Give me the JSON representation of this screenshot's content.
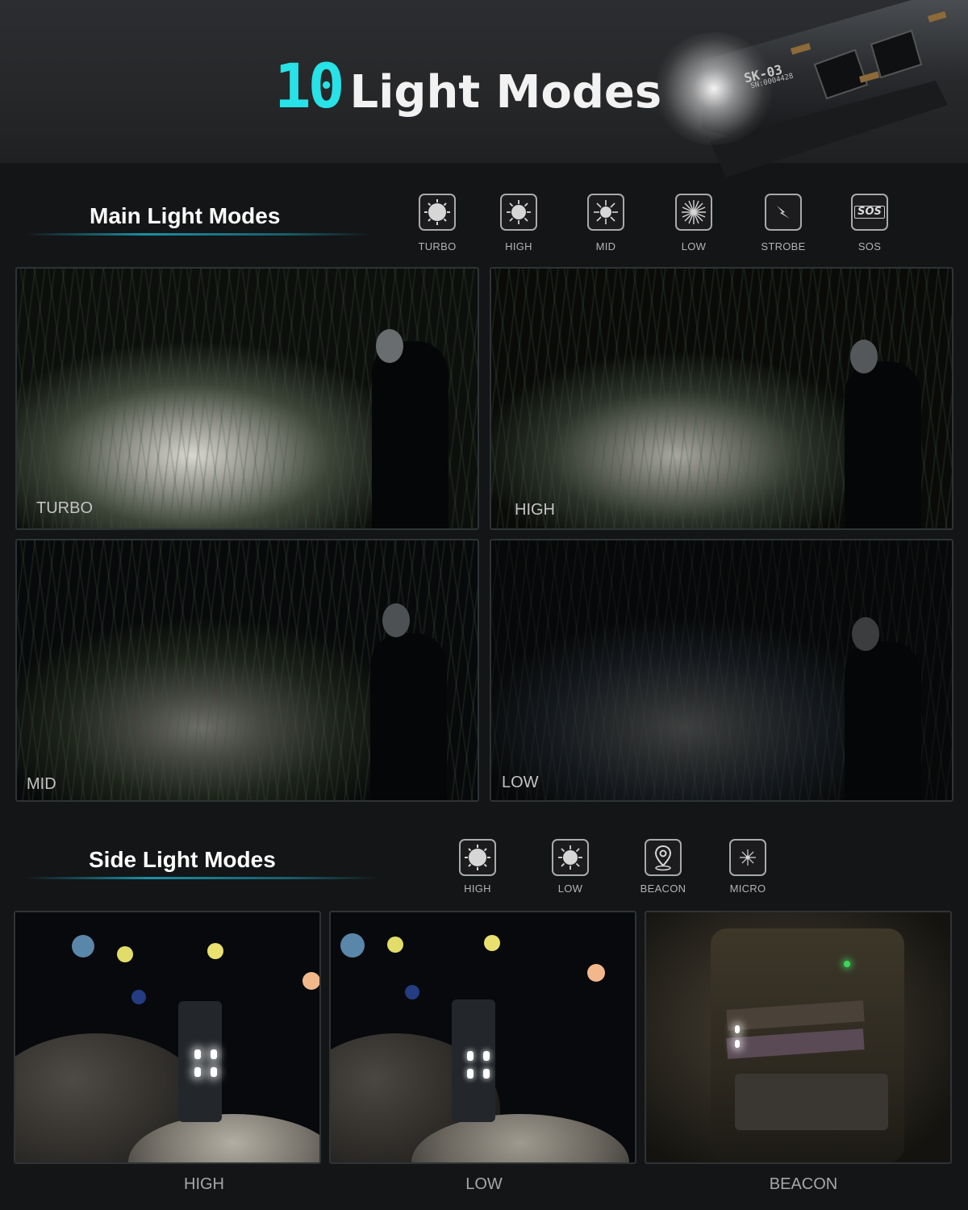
{
  "header": {
    "title_number": "10",
    "title_text": "Light Modes",
    "flashlight_model": "SK-03",
    "flashlight_serial": "SN:0004428"
  },
  "main_section": {
    "title": "Main Light Modes",
    "modes": [
      {
        "label": "TURBO",
        "icon": "sun-full-icon"
      },
      {
        "label": "HIGH",
        "icon": "sun-high-icon"
      },
      {
        "label": "MID",
        "icon": "sun-mid-icon"
      },
      {
        "label": "LOW",
        "icon": "sun-low-icon"
      },
      {
        "label": "STROBE",
        "icon": "lightning-icon"
      },
      {
        "label": "SOS",
        "icon": "sos-icon",
        "glyph": "SOS"
      }
    ],
    "photos": [
      {
        "label": "TURBO"
      },
      {
        "label": "HIGH"
      },
      {
        "label": "MID"
      },
      {
        "label": "LOW"
      }
    ]
  },
  "side_section": {
    "title": "Side Light Modes",
    "modes": [
      {
        "label": "HIGH",
        "icon": "sun-full-icon"
      },
      {
        "label": "LOW",
        "icon": "sun-high-icon"
      },
      {
        "label": "BEACON",
        "icon": "location-pin-icon"
      },
      {
        "label": "MICRO",
        "icon": "sun-low-icon"
      }
    ],
    "photos": [
      {
        "label": "HIGH"
      },
      {
        "label": "LOW"
      },
      {
        "label": "BEACON"
      }
    ]
  },
  "colors": {
    "accent": "#27e2e6",
    "line": "#1b8fa6",
    "background": "#141516"
  }
}
